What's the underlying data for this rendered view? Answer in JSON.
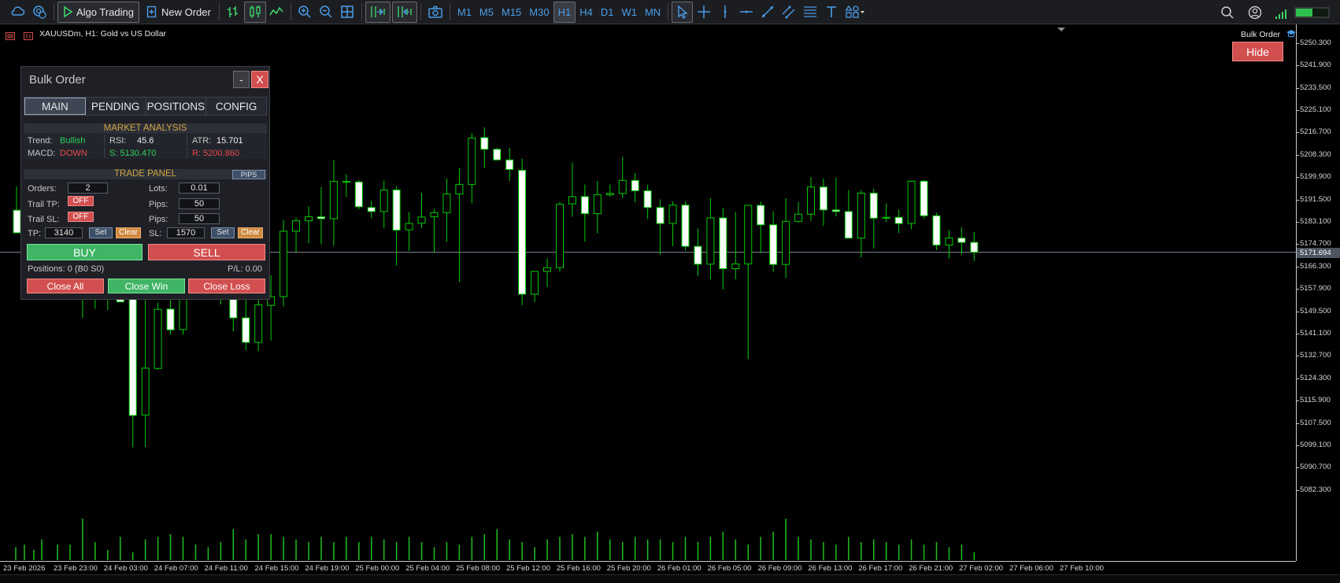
{
  "toolbar": {
    "algo_trading_label": "Algo Trading",
    "new_order_label": "New Order",
    "timeframes": [
      "M1",
      "M5",
      "M15",
      "M30",
      "H1",
      "H4",
      "D1",
      "W1",
      "MN"
    ],
    "active_timeframe": "H1"
  },
  "chart": {
    "symbol_title": "XAUUSDm, H1:  Gold vs US Dollar",
    "indicator_tag": "Bulk Order",
    "hide_button_label": "Hide",
    "current_price": "5171.694",
    "price_labels": [
      "5250.300",
      "5241.900",
      "5233.500",
      "5225.100",
      "5216.700",
      "5208.300",
      "5199.900",
      "5191.500",
      "5183.100",
      "5174.700",
      "5166.300",
      "5157.900",
      "5149.500",
      "5141.100",
      "5132.700",
      "5124.300",
      "5115.900",
      "5107.500",
      "5099.100",
      "5090.700",
      "5082.300"
    ],
    "time_labels": [
      "23 Feb 2026",
      "23 Feb 23:00",
      "24 Feb 03:00",
      "24 Feb 07:00",
      "24 Feb 11:00",
      "24 Feb 15:00",
      "24 Feb 19:00",
      "25 Feb 00:00",
      "25 Feb 04:00",
      "25 Feb 08:00",
      "25 Feb 12:00",
      "25 Feb 16:00",
      "25 Feb 20:00",
      "26 Feb 01:00",
      "26 Feb 05:00",
      "26 Feb 09:00",
      "26 Feb 13:00",
      "26 Feb 17:00",
      "26 Feb 21:00",
      "27 Feb 02:00",
      "27 Feb 06:00",
      "27 Feb 10:00"
    ],
    "colors": {
      "bull_body": "#000000",
      "bear_body": "#ffffff",
      "wick": "#00cc00",
      "volume": "#1fbf1f",
      "price_line": "#7f8a99"
    }
  },
  "panel": {
    "title": "Bulk Order",
    "minimize_label": "-",
    "close_label": "X",
    "tabs": [
      "MAIN",
      "PENDING",
      "POSITIONS",
      "CONFIG"
    ],
    "active_tab": "MAIN",
    "market_analysis": {
      "heading": "MARKET ANALYSIS",
      "trend_label": "Trend:",
      "trend_value": "Bullish",
      "rsi_label": "RSI:",
      "rsi_value": "45.6",
      "atr_label": "ATR:",
      "atr_value": "15.701",
      "macd_label": "MACD:",
      "macd_value": "DOWN",
      "support_value": "S: 5130.470",
      "resistance_value": "R: 5200.860"
    },
    "trade_panel": {
      "heading": "TRADE PANEL",
      "pips_button": "PIPS",
      "orders_label": "Orders:",
      "orders_value": "2",
      "lots_label": "Lots:",
      "lots_value": "0.01",
      "trail_tp_label": "Trail TP:",
      "trail_tp_state": "OFF",
      "trail_tp_pips_label": "Pips:",
      "trail_tp_pips_value": "50",
      "trail_sl_label": "Trail SL:",
      "trail_sl_state": "OFF",
      "trail_sl_pips_label": "Pips:",
      "trail_sl_pips_value": "50",
      "tp_label": "TP:",
      "tp_value": "3140",
      "sl_label": "SL:",
      "sl_value": "1570",
      "set_label": "Set",
      "clear_label": "Clear"
    },
    "buy_label": "BUY",
    "sell_label": "SELL",
    "positions_text": "Positions: 0 (B0 S0)",
    "pl_text": "P/L: 0.00",
    "close_all_label": "Close All",
    "close_win_label": "Close Win",
    "close_loss_label": "Close Loss"
  },
  "chart_data": {
    "type": "candlestick",
    "symbol": "XAUUSDm",
    "timeframe": "H1",
    "y_range": [
      5076.0,
      5255.0
    ],
    "current_price": 5171.694,
    "candles": [
      [
        5177.5,
        5198.6,
        5174.3,
        5188.9
      ],
      [
        5189.0,
        5197.2,
        5180.8,
        5183.5
      ],
      [
        5183.8,
        5230.4,
        5147.0,
        5180.5
      ],
      [
        5180.0,
        5208.6,
        5150.4,
        5165.0
      ],
      [
        5168.0,
        5200.0,
        5150.0,
        5160.0
      ],
      [
        5160.0,
        5220.0,
        5155.0,
        5153.0
      ],
      [
        5156.7,
        5158.1,
        5098.3,
        5110.3
      ],
      [
        5110.5,
        5164.6,
        5098.4,
        5128.1
      ],
      [
        5128.0,
        5152.7,
        5127.4,
        5150.2
      ],
      [
        5150.3,
        5158.3,
        5140.7,
        5142.5
      ],
      [
        5142.6,
        5167.7,
        5140.6,
        5167.7
      ],
      [
        5167.5,
        5173.0,
        5164.0,
        5164.6
      ],
      [
        5164.6,
        5171.7,
        5154.2,
        5160.4
      ],
      [
        5160.6,
        5175.6,
        5152.0,
        5167.1
      ],
      [
        5167.0,
        5172.4,
        5142.0,
        5147.0
      ],
      [
        5147.0,
        5156.1,
        5134.9,
        5137.8
      ],
      [
        5137.8,
        5155.4,
        5134.5,
        5151.9
      ],
      [
        5151.7,
        5163.0,
        5138.5,
        5155.0
      ],
      [
        5155.0,
        5183.8,
        5151.3,
        5179.6
      ],
      [
        5179.6,
        5184.8,
        5171.6,
        5183.5
      ],
      [
        5183.5,
        5189.0,
        5175.1,
        5185.0
      ],
      [
        5185.0,
        5196.2,
        5174.7,
        5184.3
      ],
      [
        5184.3,
        5206.3,
        5174.1,
        5198.3
      ],
      [
        5198.3,
        5201.0,
        5192.5,
        5198.1
      ],
      [
        5198.1,
        5198.8,
        5187.8,
        5188.8
      ],
      [
        5188.5,
        5191.0,
        5184.5,
        5187.0
      ],
      [
        5187.0,
        5198.6,
        5180.7,
        5195.1
      ],
      [
        5195.1,
        5196.5,
        5166.7,
        5180.0
      ],
      [
        5180.1,
        5186.7,
        5172.2,
        5182.5
      ],
      [
        5182.6,
        5194.0,
        5180.8,
        5184.9
      ],
      [
        5185.0,
        5188.0,
        5171.5,
        5186.6
      ],
      [
        5186.6,
        5199.4,
        5175.6,
        5193.6
      ],
      [
        5193.6,
        5203.3,
        5160.5,
        5197.2
      ],
      [
        5197.2,
        5216.4,
        5190.1,
        5214.6
      ],
      [
        5214.8,
        5218.7,
        5203.4,
        5210.4
      ],
      [
        5210.4,
        5211.0,
        5206.8,
        5206.4
      ],
      [
        5206.4,
        5210.9,
        5198.5,
        5202.8
      ],
      [
        5202.5,
        5206.8,
        5151.8,
        5155.9
      ],
      [
        5155.9,
        5160.3,
        5153.0,
        5164.5
      ],
      [
        5164.5,
        5169.4,
        5158.6,
        5165.9
      ],
      [
        5165.9,
        5190.6,
        5164.4,
        5189.7
      ],
      [
        5189.9,
        5205.4,
        5185.0,
        5192.6
      ],
      [
        5192.6,
        5197.1,
        5175.7,
        5186.2
      ],
      [
        5186.2,
        5198.5,
        5178.8,
        5193.3
      ],
      [
        5193.3,
        5197.1,
        5192.6,
        5193.8
      ],
      [
        5193.8,
        5207.5,
        5192.0,
        5198.7
      ],
      [
        5198.7,
        5201.5,
        5190.5,
        5194.8
      ],
      [
        5194.8,
        5197.1,
        5184.2,
        5188.5
      ],
      [
        5188.5,
        5191.5,
        5170.8,
        5182.5
      ],
      [
        5182.5,
        5190.8,
        5174.0,
        5189.4
      ],
      [
        5189.4,
        5190.8,
        5172.4,
        5173.9
      ],
      [
        5173.9,
        5180.6,
        5162.8,
        5167.2
      ],
      [
        5167.2,
        5192.0,
        5161.5,
        5184.6
      ],
      [
        5184.6,
        5188.3,
        5157.7,
        5165.5
      ],
      [
        5165.5,
        5186.7,
        5161.5,
        5167.3
      ],
      [
        5167.3,
        5189.3,
        5131.5,
        5189.3
      ],
      [
        5189.3,
        5190.8,
        5171.4,
        5182.0
      ],
      [
        5182.0,
        5187.1,
        5164.3,
        5167.1
      ],
      [
        5167.1,
        5192.0,
        5162.0,
        5183.3
      ],
      [
        5183.3,
        5190.6,
        5182.8,
        5186.0
      ],
      [
        5186.0,
        5200.0,
        5183.5,
        5196.2
      ],
      [
        5196.2,
        5199.4,
        5181.7,
        5187.6
      ],
      [
        5187.6,
        5199.8,
        5185.2,
        5187.0
      ],
      [
        5187.0,
        5195.1,
        5178.5,
        5177.0
      ],
      [
        5177.0,
        5195.0,
        5169.7,
        5193.9
      ],
      [
        5193.9,
        5195.5,
        5173.1,
        5184.5
      ],
      [
        5184.5,
        5190.1,
        5183.0,
        5184.8
      ],
      [
        5184.8,
        5187.7,
        5178.9,
        5182.5
      ],
      [
        5182.5,
        5198.4,
        5180.3,
        5198.4
      ],
      [
        5198.4,
        5198.9,
        5184.4,
        5185.4
      ],
      [
        5185.4,
        5186.5,
        5172.5,
        5174.4
      ],
      [
        5174.4,
        5180.0,
        5169.3,
        5177.0
      ],
      [
        5177.0,
        5181.1,
        5170.8,
        5175.4
      ],
      [
        5175.4,
        5179.2,
        5168.4,
        5171.7
      ]
    ],
    "volumes": [
      6,
      6,
      16,
      7,
      4,
      9,
      3,
      8,
      9,
      10,
      9,
      6,
      5,
      7,
      12,
      8,
      10,
      10,
      9,
      8,
      7,
      9,
      7,
      9,
      7,
      9,
      8,
      7,
      9,
      7,
      5,
      7,
      6,
      9,
      10,
      12,
      8,
      7,
      5,
      8,
      9,
      10,
      9,
      11,
      8,
      7,
      9,
      8,
      8,
      7,
      9,
      7,
      9,
      11,
      8,
      6,
      9,
      11,
      16,
      9,
      8,
      7,
      6,
      9,
      7,
      8,
      7,
      6,
      8,
      6,
      7,
      5,
      6,
      3
    ],
    "early_partial_candles": [
      [
        5187.5,
        5196.4,
        5182.5,
        5179.0
      ]
    ]
  }
}
